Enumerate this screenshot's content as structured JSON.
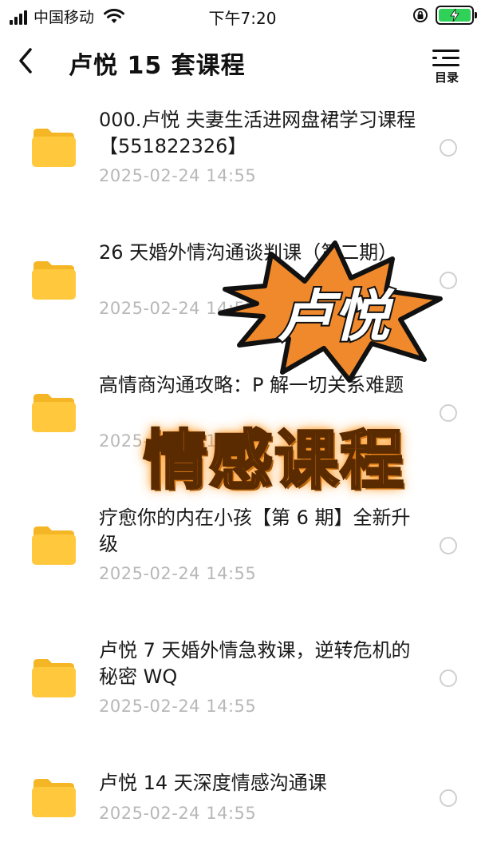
{
  "status_bar": {
    "carrier": "中国移动",
    "time": "下午7:20"
  },
  "nav": {
    "title": "卢悦 15 套课程",
    "menu_label": "目录"
  },
  "files": [
    {
      "name": "000.卢悦 夫妻生活进网盘裙学习课程【551822326】",
      "date": "2025-02-24 14:55"
    },
    {
      "name": "26 天婚外情沟通谈判课（第二期）",
      "date": "2025-02-24 14:55"
    },
    {
      "name": "高情商沟通攻略：P 解一切关系难题",
      "date": "2025-02-24 14:55"
    },
    {
      "name": "疗愈你的内在小孩【第 6 期】全新升级",
      "date": "2025-02-24 14:55"
    },
    {
      "name": "卢悦 7 天婚外情急救课，逆转危机的秘密 WQ",
      "date": "2025-02-24 14:55"
    },
    {
      "name": "卢悦 14 天深度情感沟通课",
      "date": "2025-02-24 14:55"
    }
  ],
  "overlay": {
    "burst_text": "卢悦",
    "banner_text": "情感课程"
  },
  "colors": {
    "folder": "#ffc83d",
    "date": "#b8b8b8",
    "battery": "#2fd158",
    "burst": "#f0892c"
  }
}
